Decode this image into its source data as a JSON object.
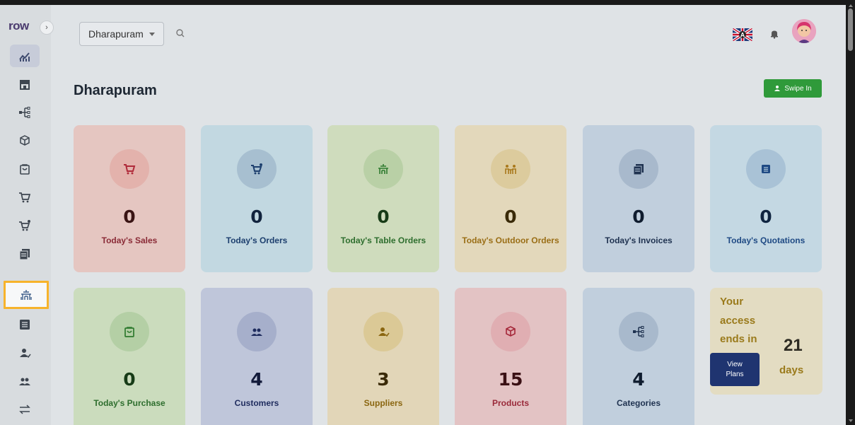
{
  "app": {
    "logo": "row",
    "collapse_glyph": "›"
  },
  "header": {
    "location": "Dharapuram",
    "language_flag": "uk-flag",
    "notification_icon": "bell-icon"
  },
  "page": {
    "title": "Dharapuram",
    "swipe_label": "Swipe In"
  },
  "cards": [
    {
      "value": "0",
      "label": "Today's Sales",
      "icon": "cart-icon"
    },
    {
      "value": "0",
      "label": "Today's Orders",
      "icon": "cart-plus-icon"
    },
    {
      "value": "0",
      "label": "Today's Table Orders",
      "icon": "table-icon"
    },
    {
      "value": "0",
      "label": "Today's Outdoor Orders",
      "icon": "outdoor-icon"
    },
    {
      "value": "0",
      "label": "Today's Invoices",
      "icon": "invoice-icon"
    },
    {
      "value": "0",
      "label": "Today's Quotations",
      "icon": "quotation-icon"
    },
    {
      "value": "0",
      "label": "Today's Purchase",
      "icon": "purchase-icon"
    },
    {
      "value": "4",
      "label": "Customers",
      "icon": "customers-icon"
    },
    {
      "value": "3",
      "label": "Suppliers",
      "icon": "suppliers-icon"
    },
    {
      "value": "15",
      "label": "Products",
      "icon": "product-icon"
    },
    {
      "value": "4",
      "label": "Categories",
      "icon": "categories-icon"
    }
  ],
  "access": {
    "line1": "Your",
    "line2": "access",
    "line3": "ends in",
    "days_number": "21",
    "days_label": "days",
    "plans_line1": "View",
    "plans_line2": "Plans"
  },
  "colors": {
    "accent_highlight": "#f7b32b",
    "swipe_green": "#2f9a3a",
    "plans_navy": "#1f3470"
  }
}
